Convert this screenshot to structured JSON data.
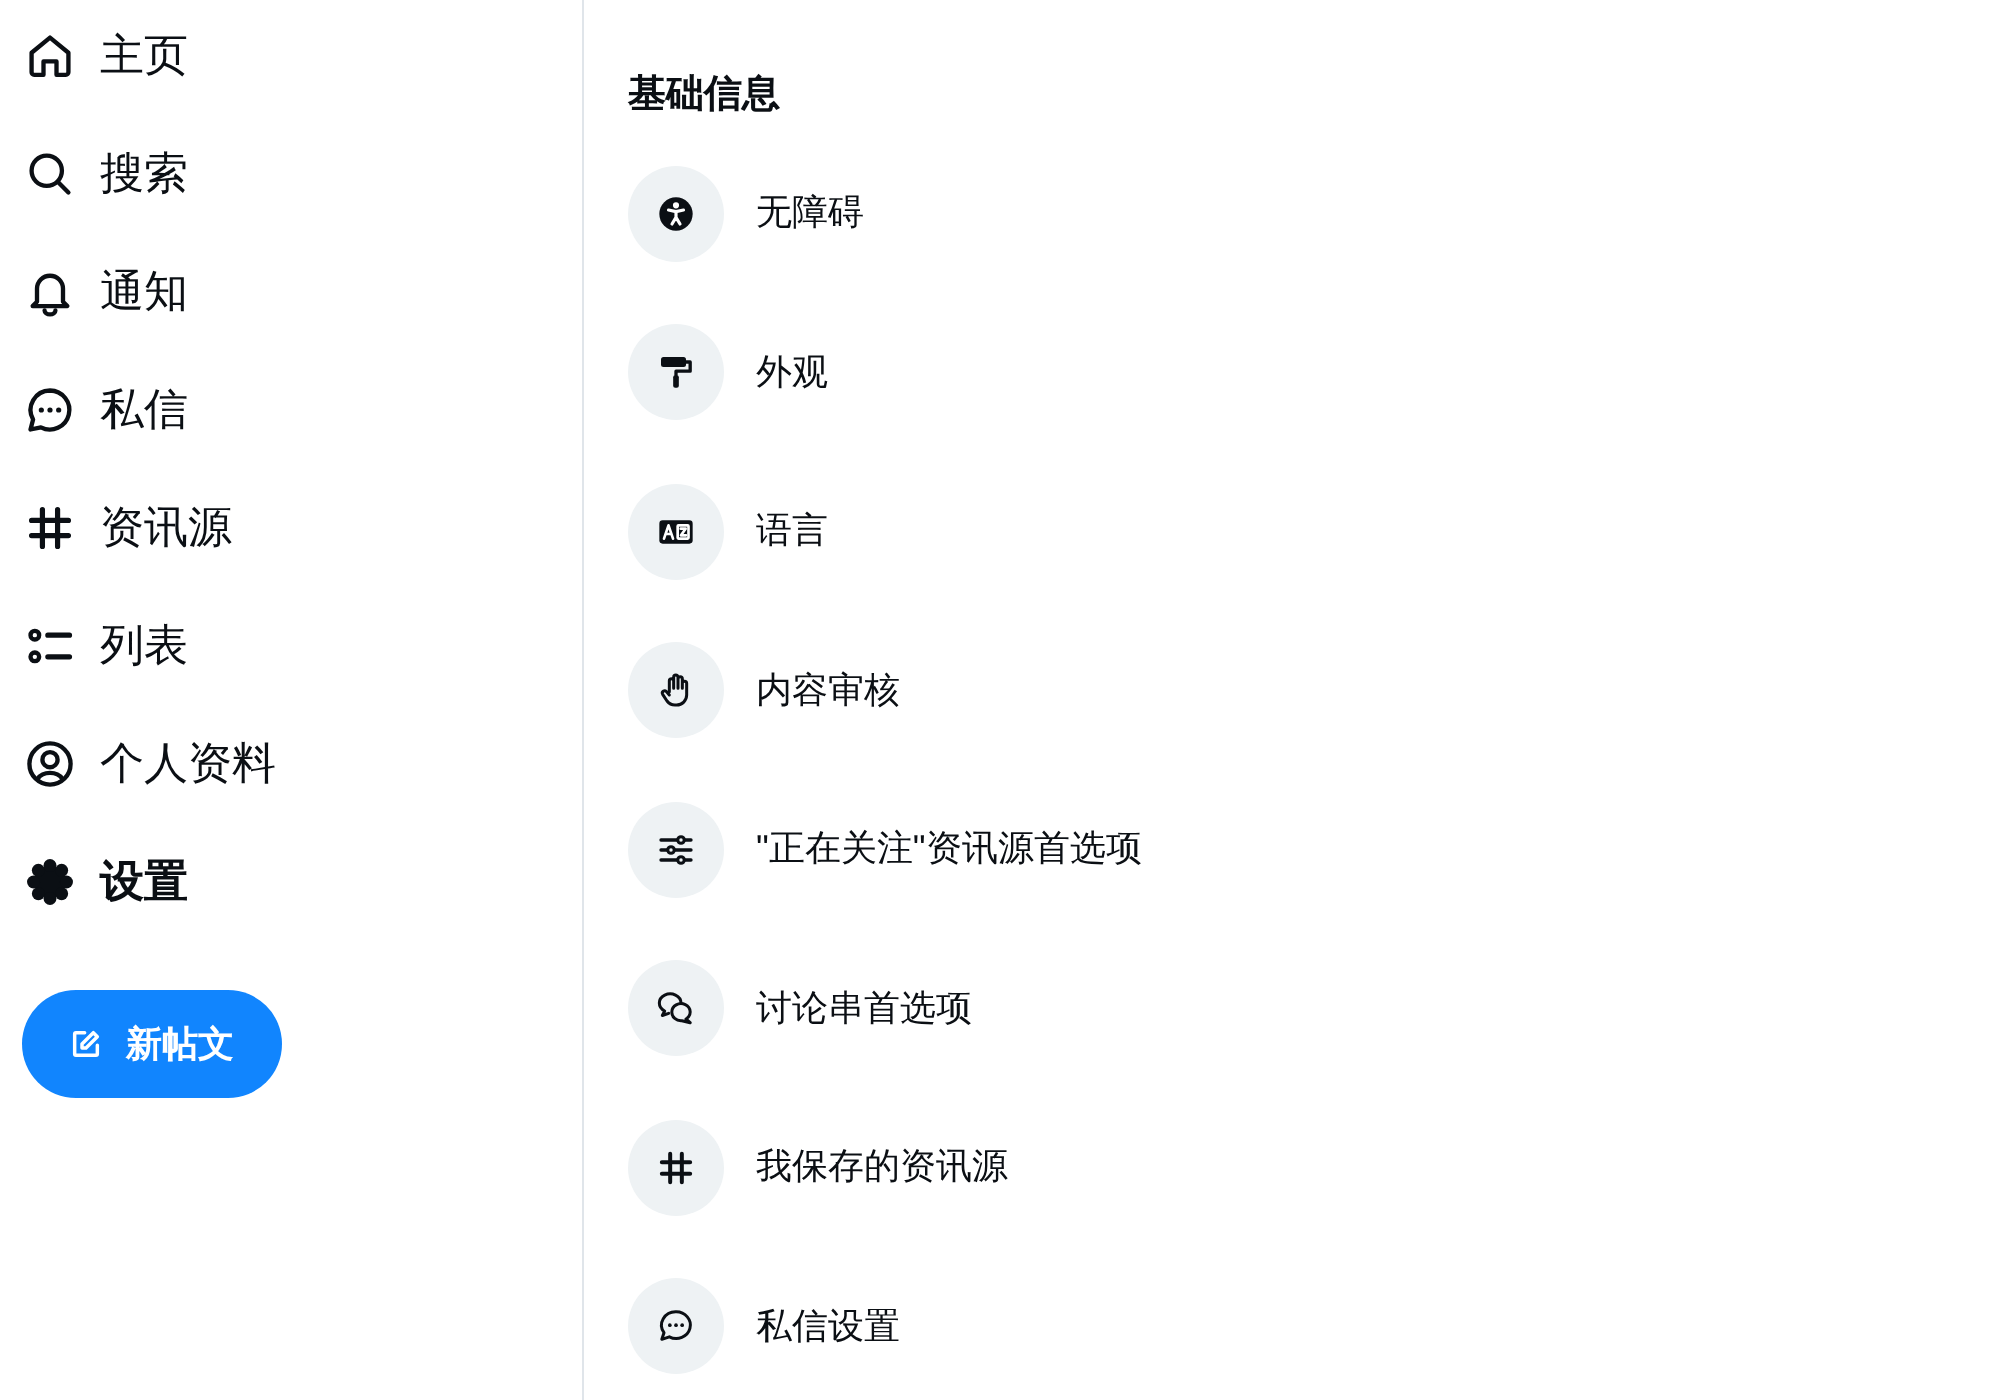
{
  "sidebar": {
    "nav": [
      {
        "label": "主页",
        "selected": false
      },
      {
        "label": "搜索",
        "selected": false
      },
      {
        "label": "通知",
        "selected": false
      },
      {
        "label": "私信",
        "selected": false
      },
      {
        "label": "资讯源",
        "selected": false
      },
      {
        "label": "列表",
        "selected": false
      },
      {
        "label": "个人资料",
        "selected": false
      },
      {
        "label": "设置",
        "selected": true
      }
    ],
    "new_post_button": {
      "label": "新帖文"
    }
  },
  "settings": {
    "section_title": "基础信息",
    "items": [
      {
        "label": "无障碍"
      },
      {
        "label": "外观"
      },
      {
        "label": "语言"
      },
      {
        "label": "内容审核"
      },
      {
        "label": "\"正在关注\"资讯源首选项"
      },
      {
        "label": "讨论串首选项"
      },
      {
        "label": "我保存的资讯源"
      },
      {
        "label": "私信设置"
      }
    ]
  }
}
